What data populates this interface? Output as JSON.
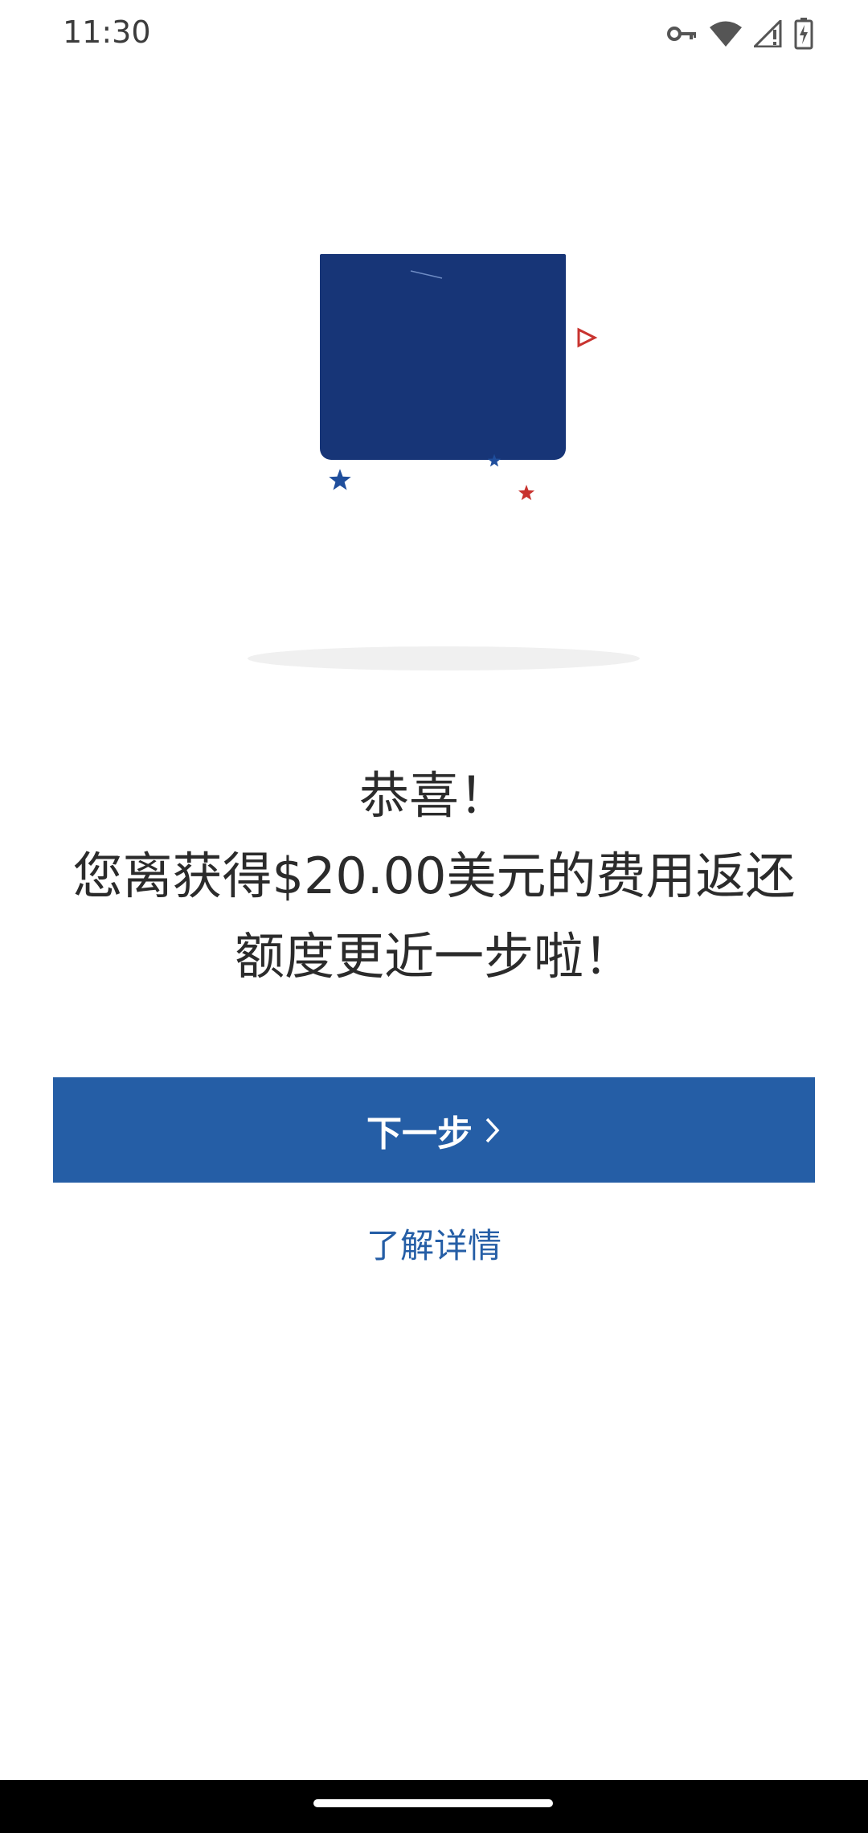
{
  "status_bar": {
    "time": "11:30",
    "icons": [
      "key-icon",
      "wifi-icon",
      "cellular-no-signal-icon",
      "battery-charging-icon"
    ]
  },
  "illustration": {
    "card_color": "#173577",
    "accent_red": "#c8332f",
    "accent_blue": "#1f4e9c"
  },
  "message": {
    "line1": "恭喜！",
    "line2": "您离获得$20.00美元的费用返还",
    "line3": "额度更近一步啦！"
  },
  "actions": {
    "next_label": "下一步",
    "learn_more_label": "了解详情"
  },
  "colors": {
    "primary": "#255ea6",
    "background": "#ffffff"
  }
}
